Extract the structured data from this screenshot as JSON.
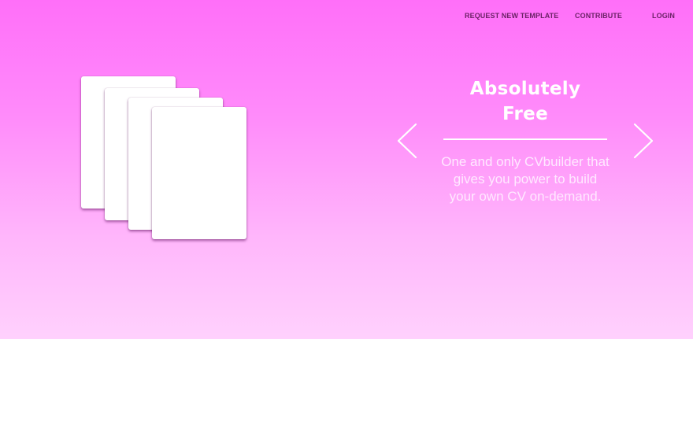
{
  "nav": {
    "request_label": "REQUEST NEW TEMPLATE",
    "contribute_label": "CONTRIBUTE",
    "login_label": "LOGIN"
  },
  "carousel": {
    "title_line1": "Absolutely",
    "title_line2": "Free",
    "description": "One and only CVbuilder that gives you power to build your own CV on-demand.",
    "prev_icon": "chevron-left-icon",
    "next_icon": "chevron-right-icon"
  },
  "colors": {
    "gradient_top": "#ff6ff9",
    "gradient_bottom": "#ffd1fd",
    "nav_text": "#6b2266",
    "card": "#ffffff"
  }
}
